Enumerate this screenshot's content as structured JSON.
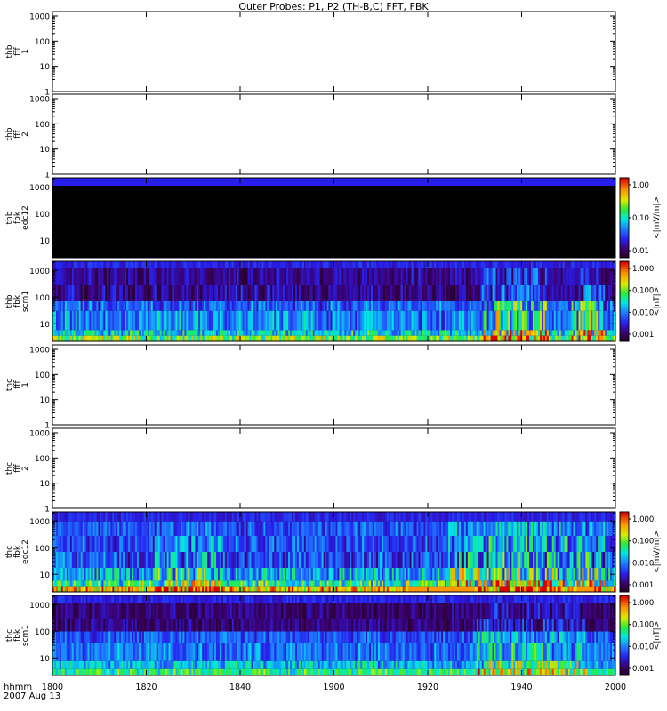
{
  "title": "Outer Probes: P1, P2 (TH-B,C) FFT, FBK",
  "footer": {
    "line1": "hhmm",
    "line2": "2007 Aug 13"
  },
  "chart_data": {
    "type": "heatmap",
    "title": "Outer Probes: P1, P2 (TH-B,C) FFT, FBK",
    "x": {
      "ticks": [
        "1800",
        "1820",
        "1840",
        "1900",
        "1920",
        "1940",
        "2000"
      ],
      "range": [
        "18:00",
        "20:00"
      ]
    },
    "colors": {
      "background": "#000000",
      "axes": "#000000"
    },
    "panels": [
      {
        "ylabel": [
          "thb",
          "fff",
          "1"
        ],
        "y_scale": "log",
        "yticks": [
          "1",
          "10",
          "100",
          "1000"
        ],
        "has_data": false
      },
      {
        "ylabel": [
          "thb",
          "fff",
          "2"
        ],
        "y_scale": "log",
        "yticks": [
          "1",
          "10",
          "100",
          "1000"
        ],
        "has_data": false
      },
      {
        "ylabel": [
          "thb",
          "fbk",
          "edc12"
        ],
        "y_scale": "log",
        "yticks": [
          "10",
          "100",
          "1000"
        ],
        "has_data": true,
        "colorbar": {
          "label": "<|mV/m|>",
          "ticks": [
            "1.00",
            "0.10",
            "0.01"
          ]
        }
      },
      {
        "ylabel": [
          "thb",
          "fbk",
          "scm1"
        ],
        "y_scale": "log",
        "yticks": [
          "10",
          "100",
          "1000"
        ],
        "has_data": true,
        "colorbar": {
          "label": "<|nT|>",
          "ticks": [
            "1.000",
            "0.100",
            "0.010",
            "0.001"
          ]
        }
      },
      {
        "ylabel": [
          "thc",
          "fff",
          "1"
        ],
        "y_scale": "log",
        "yticks": [
          "1",
          "10",
          "100",
          "1000"
        ],
        "has_data": false
      },
      {
        "ylabel": [
          "thc",
          "fff",
          "2"
        ],
        "y_scale": "log",
        "yticks": [
          "1",
          "10",
          "100",
          "1000"
        ],
        "has_data": false
      },
      {
        "ylabel": [
          "thc",
          "fbk",
          "edc12"
        ],
        "y_scale": "log",
        "yticks": [
          "10",
          "100",
          "1000"
        ],
        "has_data": true,
        "colorbar": {
          "label": "<|mV/m|>",
          "ticks": [
            "1.000",
            "0.100",
            "0.010",
            "0.001"
          ]
        }
      },
      {
        "ylabel": [
          "thc",
          "fbk",
          "scm1"
        ],
        "y_scale": "log",
        "yticks": [
          "10",
          "100",
          "1000"
        ],
        "has_data": true,
        "colorbar": {
          "label": "<|nT|>",
          "ticks": [
            "1.000",
            "0.100",
            "0.010",
            "0.001"
          ]
        }
      }
    ]
  }
}
